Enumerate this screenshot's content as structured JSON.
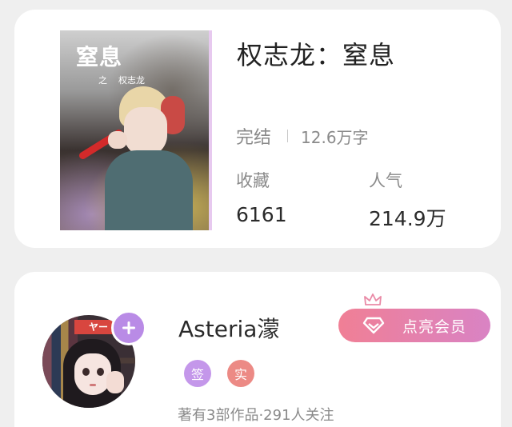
{
  "book": {
    "cover_title": "窒息",
    "cover_sub_prefix": "之",
    "cover_sub_author": "权志龙",
    "title": "权志龙：窒息",
    "status": "完结",
    "word_count": "12.6万字",
    "favorites_label": "收藏",
    "favorites_value": "6161",
    "popularity_label": "人气",
    "popularity_value": "214.9万"
  },
  "author": {
    "avatar_banner": "ヤー",
    "follow_icon": "plus-icon",
    "name": "Asteria濛",
    "badge_sign": "签",
    "badge_real": "实",
    "meta": "著有3部作品·291人关注",
    "vip_icon": "diamond-icon",
    "crown_icon": "crown-icon",
    "vip_label": "点亮会员"
  },
  "colors": {
    "follow_button": "#b98be6",
    "badge_sign": "#c497ea",
    "badge_real": "#ec8a85",
    "vip_gradient_start": "#f07f95",
    "vip_gradient_end": "#d983c4",
    "background": "#efefef"
  }
}
